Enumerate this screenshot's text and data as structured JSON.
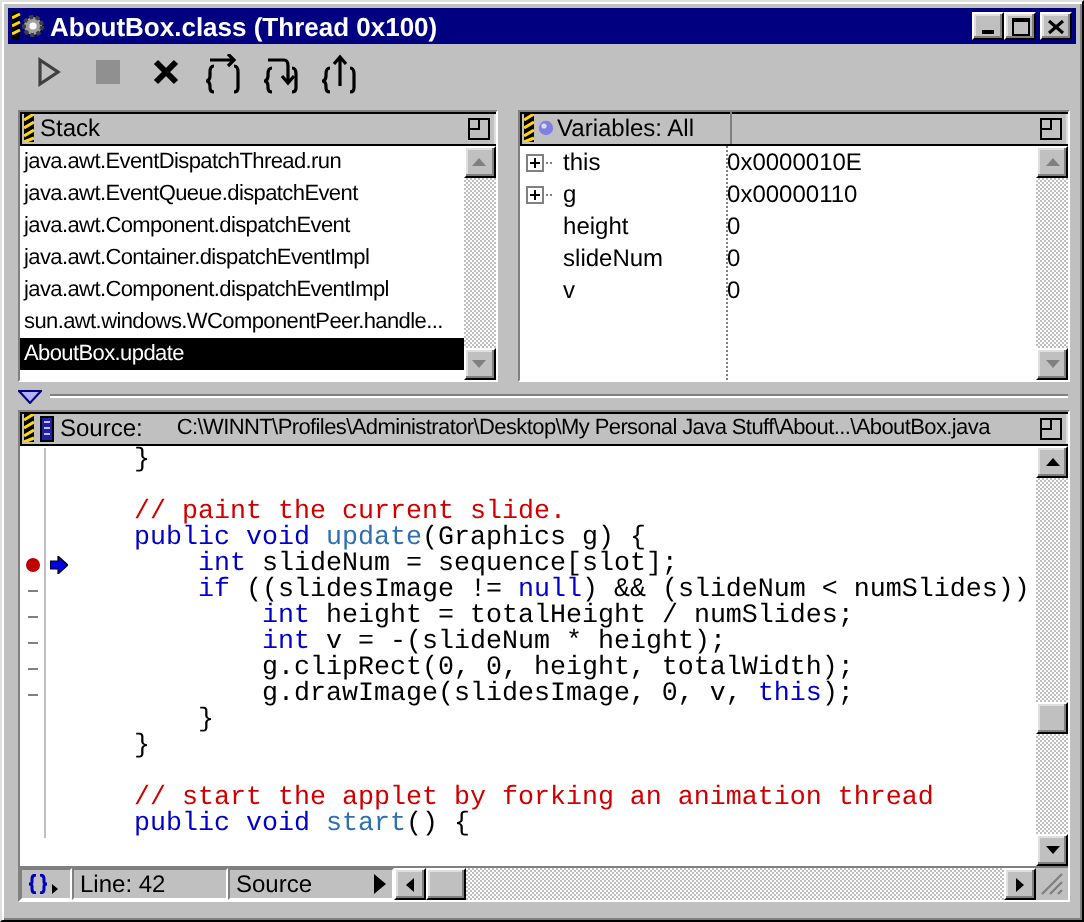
{
  "window": {
    "title": "AboutBox.class (Thread 0x100)"
  },
  "toolbar": [
    {
      "kind": "run",
      "disabled": false
    },
    {
      "kind": "stop",
      "disabled": true
    },
    {
      "kind": "kill",
      "disabled": false
    },
    {
      "kind": "step_over",
      "disabled": false
    },
    {
      "kind": "step_into",
      "disabled": false
    },
    {
      "kind": "step_out",
      "disabled": false
    }
  ],
  "stack": {
    "title": "Stack",
    "frames": [
      {
        "label": "java.awt.EventDispatchThread.run",
        "selected": false
      },
      {
        "label": "java.awt.EventQueue.dispatchEvent",
        "selected": false
      },
      {
        "label": "java.awt.Component.dispatchEvent",
        "selected": false
      },
      {
        "label": "java.awt.Container.dispatchEventImpl",
        "selected": false
      },
      {
        "label": "java.awt.Component.dispatchEventImpl",
        "selected": false
      },
      {
        "label": "sun.awt.windows.WComponentPeer.handle...",
        "selected": false
      },
      {
        "label": "AboutBox.update",
        "selected": true
      }
    ]
  },
  "variables": {
    "title": "Variables: All",
    "rows": [
      {
        "name": "this",
        "value": "0x0000010E",
        "expandable": true
      },
      {
        "name": "g",
        "value": "0x00000110",
        "expandable": true
      },
      {
        "name": "height",
        "value": "0",
        "expandable": false
      },
      {
        "name": "slideNum",
        "value": "0",
        "expandable": false
      },
      {
        "name": "v",
        "value": "0",
        "expandable": false
      }
    ]
  },
  "source": {
    "label": "Source:",
    "path": "C:\\WINNT\\Profiles\\Administrator\\Desktop\\My Personal Java Stuff\\About...\\AboutBox.java",
    "lines": [
      {
        "breakpoint": false,
        "current": false,
        "executable": false,
        "tokens": [
          {
            "kind": "text",
            "text": "    }"
          }
        ]
      },
      {
        "breakpoint": false,
        "current": false,
        "executable": false
      },
      {
        "breakpoint": false,
        "current": false,
        "executable": false,
        "tokens": [
          {
            "kind": "comment",
            "text": "    // paint the current slide."
          }
        ]
      },
      {
        "breakpoint": false,
        "current": false,
        "executable": false,
        "tokens": [
          {
            "kind": "keyword",
            "text": "    public void "
          },
          {
            "kind": "method",
            "text": "update"
          },
          {
            "kind": "text",
            "text": "(Graphics g) {"
          }
        ]
      },
      {
        "breakpoint": true,
        "current": true,
        "executable": false,
        "tokens": [
          {
            "kind": "keyword",
            "text": "        int"
          },
          {
            "kind": "text",
            "text": " slideNum = sequence[slot];"
          }
        ]
      },
      {
        "breakpoint": false,
        "current": false,
        "executable": true,
        "tokens": [
          {
            "kind": "keyword",
            "text": "        if"
          },
          {
            "kind": "text",
            "text": " ((slidesImage != "
          },
          {
            "kind": "keyword",
            "text": "null"
          },
          {
            "kind": "text",
            "text": ") && (slideNum < numSlides))"
          }
        ]
      },
      {
        "breakpoint": false,
        "current": false,
        "executable": true,
        "tokens": [
          {
            "kind": "keyword",
            "text": "            int"
          },
          {
            "kind": "text",
            "text": " height = totalHeight / numSlides;"
          }
        ]
      },
      {
        "breakpoint": false,
        "current": false,
        "executable": true,
        "tokens": [
          {
            "kind": "keyword",
            "text": "            int"
          },
          {
            "kind": "text",
            "text": " v = -(slideNum * height);"
          }
        ]
      },
      {
        "breakpoint": false,
        "current": false,
        "executable": true,
        "tokens": [
          {
            "kind": "text",
            "text": "            g.clipRect(0, 0, height, totalWidth);"
          }
        ]
      },
      {
        "breakpoint": false,
        "current": false,
        "executable": true,
        "tokens": [
          {
            "kind": "text",
            "text": "            g.drawImage(slidesImage, 0, v, "
          },
          {
            "kind": "keyword",
            "text": "this"
          },
          {
            "kind": "text",
            "text": ");"
          }
        ]
      },
      {
        "breakpoint": false,
        "current": false,
        "executable": false,
        "tokens": [
          {
            "kind": "text",
            "text": "        }"
          }
        ]
      },
      {
        "breakpoint": false,
        "current": false,
        "executable": false,
        "tokens": [
          {
            "kind": "text",
            "text": "    }"
          }
        ]
      },
      {
        "breakpoint": false,
        "current": false,
        "executable": false
      },
      {
        "breakpoint": false,
        "current": false,
        "executable": false,
        "tokens": [
          {
            "kind": "comment",
            "text": "    // start the applet by forking an animation thread"
          }
        ]
      },
      {
        "breakpoint": false,
        "current": false,
        "executable": false,
        "tokens": [
          {
            "kind": "keyword",
            "text": "    public void "
          },
          {
            "kind": "method",
            "text": "start"
          },
          {
            "kind": "text",
            "text": "() {"
          }
        ]
      }
    ]
  },
  "status": {
    "line": "Line: 42",
    "view": "Source"
  }
}
